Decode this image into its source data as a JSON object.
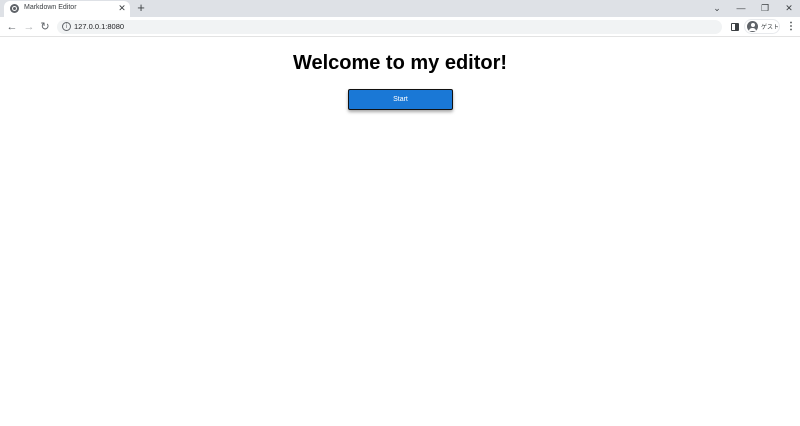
{
  "browser": {
    "tab": {
      "title": "Markdown Editor",
      "close_glyph": "✕",
      "favicon": "globe-icon"
    },
    "new_tab_glyph": "+",
    "window_controls": {
      "tab_search_glyph": "⌄",
      "minimize_glyph": "—",
      "restore_glyph": "❐",
      "close_glyph": "✕"
    },
    "toolbar": {
      "back_glyph": "←",
      "forward_glyph": "→",
      "reload_glyph": "↻",
      "url": "127.0.0.1:8080",
      "info_glyph": "i",
      "profile_label": "ゲスト",
      "menu_glyph": "⋮"
    }
  },
  "page": {
    "heading": "Welcome to my editor!",
    "start_button_label": "Start",
    "accent_color": "#1a78d6"
  }
}
